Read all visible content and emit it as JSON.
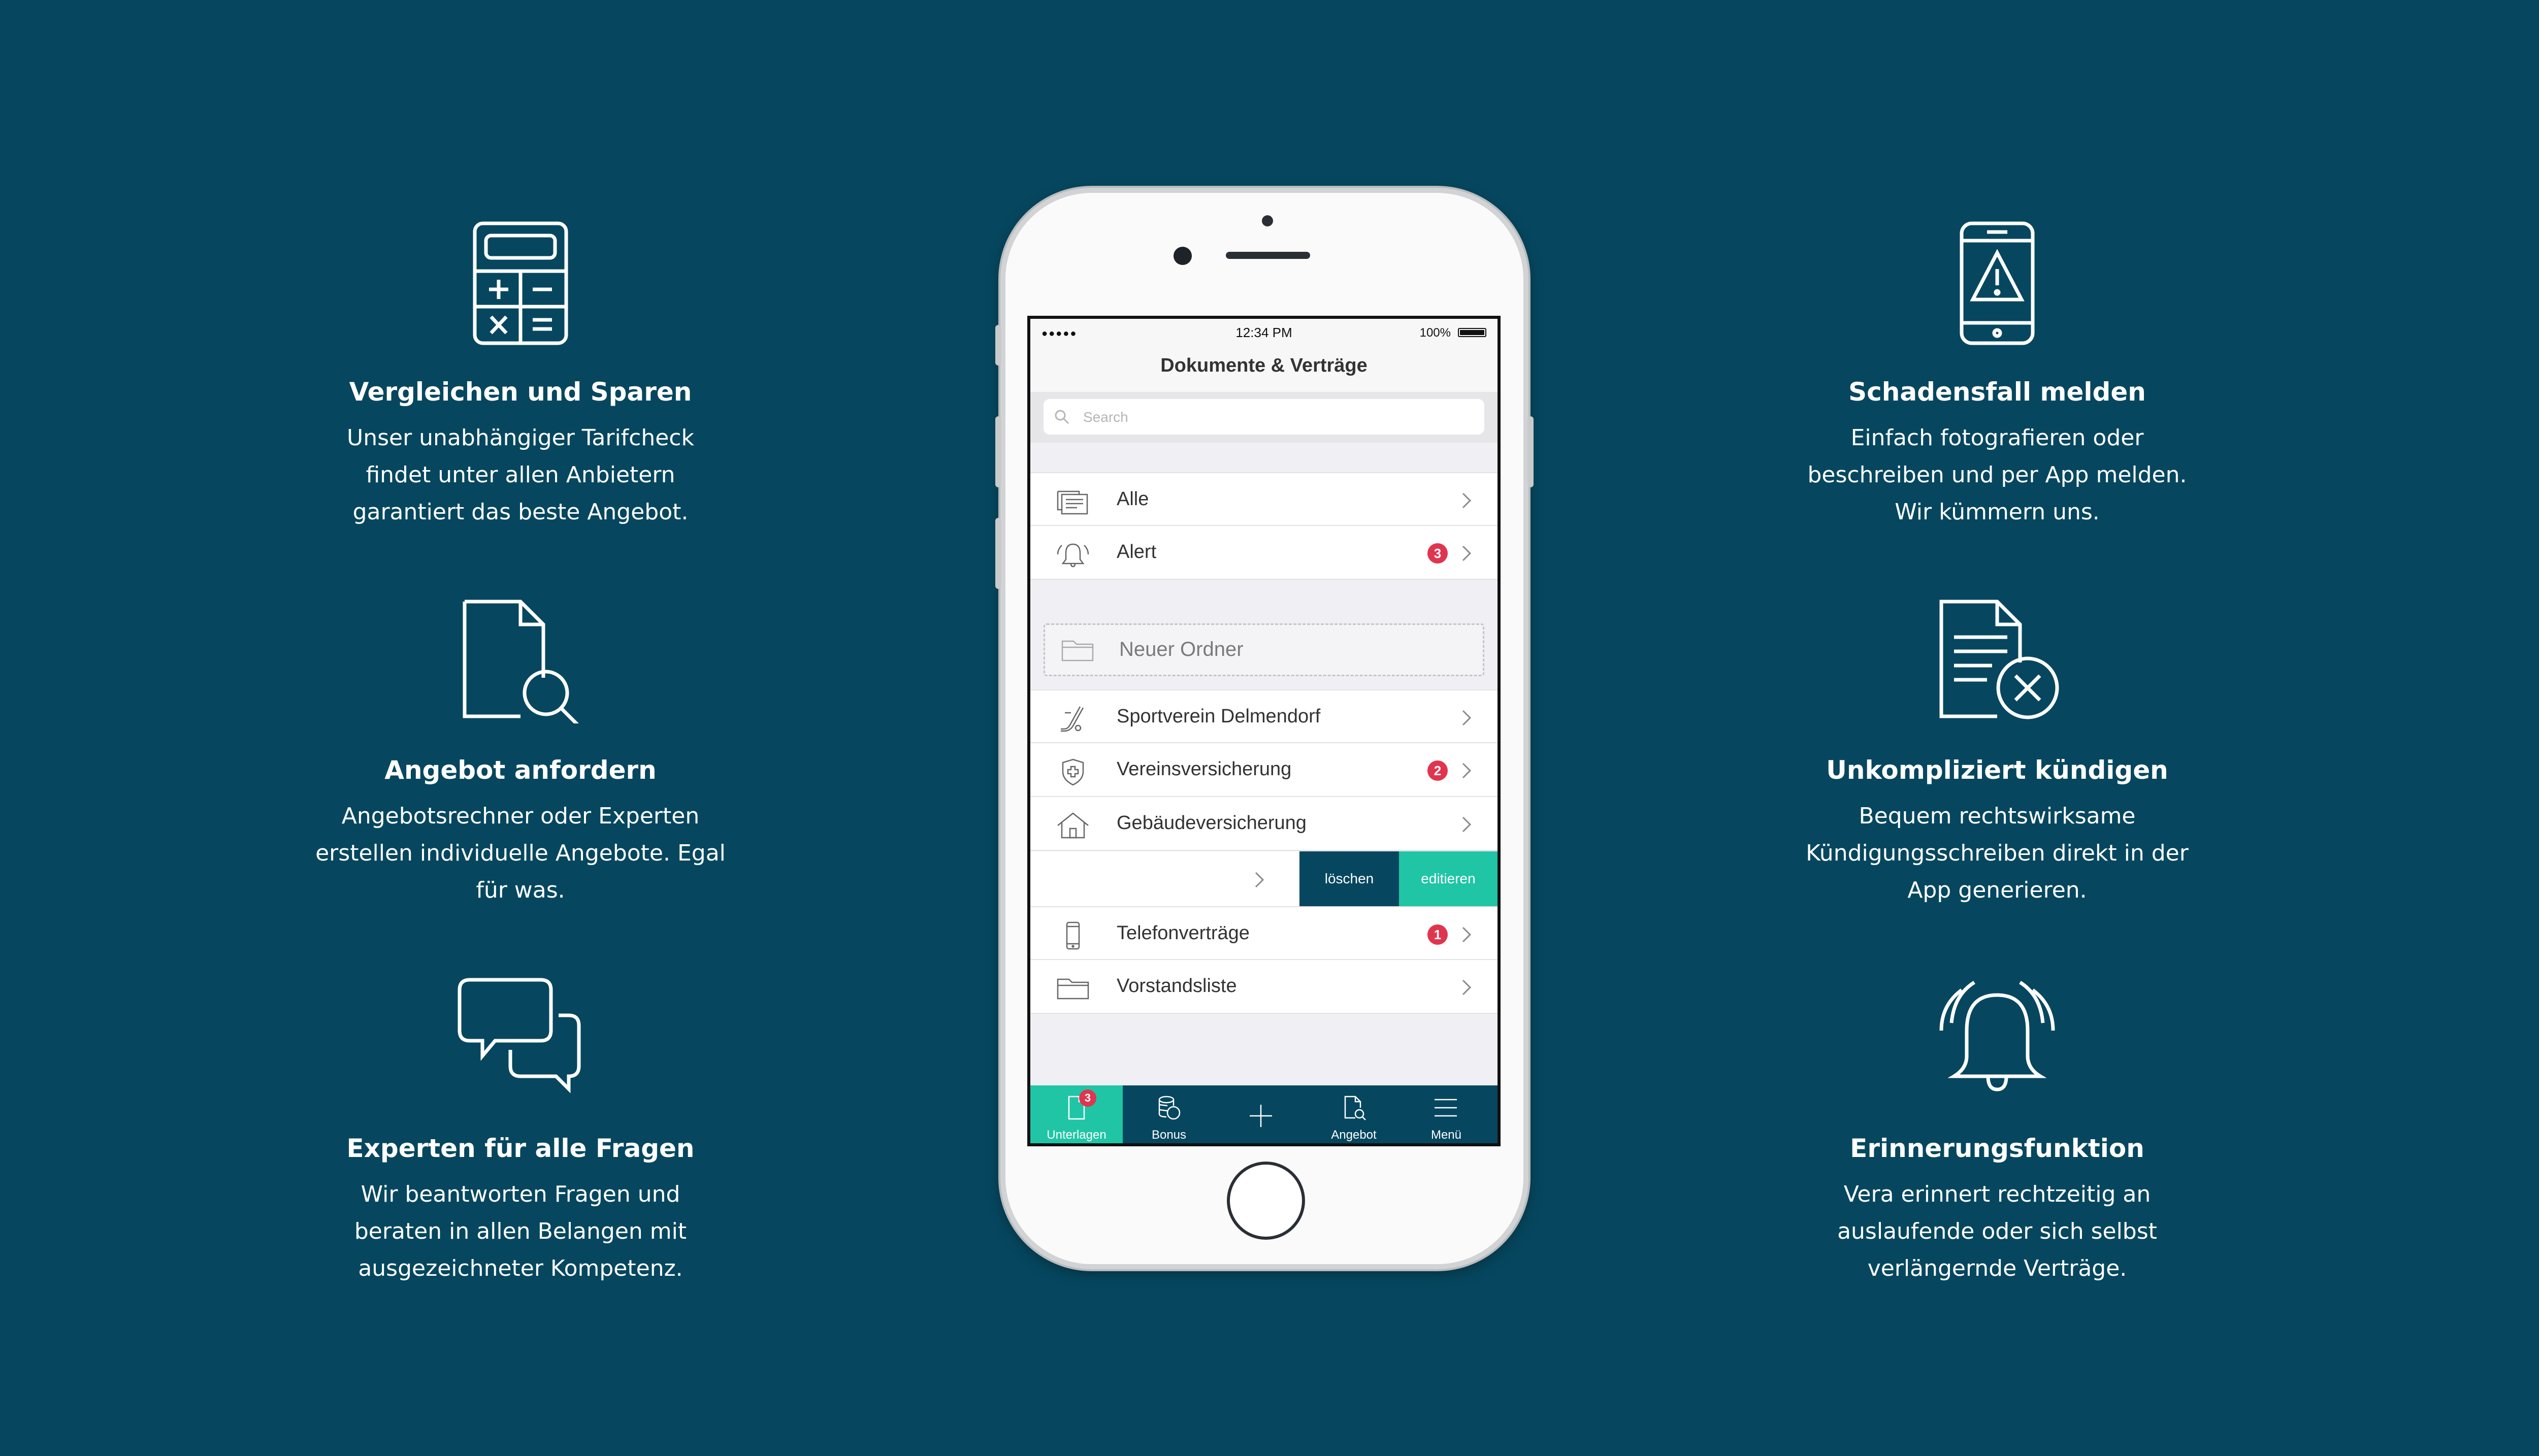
{
  "colors": {
    "background": "#06475f",
    "accent": "#20c5a5",
    "badge": "#e0354f"
  },
  "features_left": [
    {
      "icon": "calculator-icon",
      "title": "Vergleichen und Sparen",
      "lines": [
        "Unser unabhängiger Tarifcheck",
        "findet unter allen Anbietern",
        "garantiert das beste Angebot."
      ]
    },
    {
      "icon": "document-search-icon",
      "title": "Angebot anfordern",
      "lines": [
        "Angebotsrechner oder Experten",
        "erstellen individuelle Angebote. Egal",
        "für was."
      ]
    },
    {
      "icon": "chat-bubbles-icon",
      "title": "Experten für alle Fragen",
      "lines": [
        "Wir beantworten Fragen und",
        "beraten in allen Belangen mit",
        "ausgezeichneter Kompetenz."
      ]
    }
  ],
  "features_right": [
    {
      "icon": "phone-warning-icon",
      "title": "Schadensfall melden",
      "lines": [
        "Einfach fotografieren oder",
        "beschreiben und per App melden.",
        "Wir kümmern uns."
      ]
    },
    {
      "icon": "document-cancel-icon",
      "title": "Unkompliziert kündigen",
      "lines": [
        "Bequem rechtswirksame",
        "Kündigungsschreiben direkt in der",
        "App generieren."
      ]
    },
    {
      "icon": "bell-ringing-icon",
      "title": "Erinnerungsfunktion",
      "lines": [
        "Vera erinnert rechtzeitig an",
        "auslaufende oder sich selbst",
        "verlängernde Verträge."
      ]
    }
  ],
  "phone": {
    "status": {
      "signal": "●●●●● ",
      "time": "12:34 PM",
      "battery": "100%"
    },
    "title": "Dokumente & Verträge",
    "search_placeholder": "Search",
    "rows_top": [
      {
        "icon": "documents-stack-icon",
        "label": "Alle"
      },
      {
        "icon": "alarm-bell-icon",
        "label": "Alert",
        "badge": "3"
      }
    ],
    "new_folder": "Neuer Ordner",
    "rows_folders": [
      {
        "icon": "hockey-icon",
        "label": "Sportverein Delmendorf"
      },
      {
        "icon": "shield-cross-icon",
        "label": "Vereinsversicherung",
        "badge": "2"
      },
      {
        "icon": "house-icon",
        "label": "Gebäudeversicherung"
      }
    ],
    "swipe_actions": {
      "delete": "löschen",
      "edit": "editieren"
    },
    "rows_bottom": [
      {
        "icon": "smartphone-icon",
        "label": "Telefonverträge",
        "badge": "1"
      },
      {
        "icon": "folder-icon",
        "label": "Vorstandsliste"
      }
    ],
    "tabs": [
      {
        "icon": "document-icon",
        "label": "Unterlagen",
        "badge": "3"
      },
      {
        "icon": "coins-icon",
        "label": "Bonus"
      },
      {
        "icon": "plus-icon",
        "label": ""
      },
      {
        "icon": "offer-search-icon",
        "label": "Angebot"
      },
      {
        "icon": "menu-icon",
        "label": "Menü"
      }
    ]
  }
}
